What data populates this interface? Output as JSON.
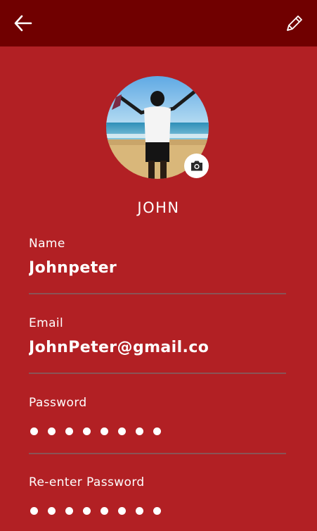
{
  "app_bar": {
    "back_icon": "arrow-left-icon",
    "edit_icon": "pencil-icon",
    "background": "#700000"
  },
  "profile": {
    "avatar_icon": "camera-icon",
    "display_name": "JOHN"
  },
  "form": {
    "name": {
      "label": "Name",
      "value": "Johnpeter"
    },
    "email": {
      "label": "Email",
      "value": "JohnPeter@gmail.co"
    },
    "password": {
      "label": "Password",
      "masked_length": 8
    },
    "reenter_password": {
      "label": "Re-enter Password",
      "masked_length": 8
    }
  },
  "colors": {
    "background": "#b22024",
    "divider": "#8a5356",
    "text": "#ffffff"
  }
}
